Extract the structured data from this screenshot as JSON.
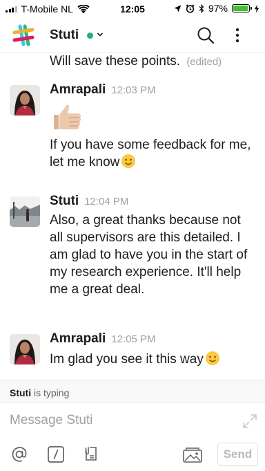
{
  "status_bar": {
    "carrier": "T-Mobile NL",
    "time": "12:05",
    "battery_percent": "97%",
    "battery_level": 0.97,
    "battery_color": "#3fc230"
  },
  "header": {
    "logo_icon": "slack-logo-icon",
    "channel_name": "Stuti",
    "presence_color": "#2bac76",
    "dropdown_icon": "chevron-down-icon",
    "search_icon": "search-icon",
    "more_icon": "more-vertical-icon"
  },
  "messages": {
    "previous": {
      "text": "Will save these points.",
      "edited_label": "(edited)"
    },
    "items": [
      {
        "author": "Amrapali",
        "time": "12:03 PM",
        "emoji": "thumbs-up-icon",
        "text": "If you have some feedback for me, let me know",
        "trailing_emoji": "slightly-smiling-face-icon"
      },
      {
        "author": "Stuti",
        "time": "12:04 PM",
        "text": "Also, a great thanks because not all supervisors are this detailed. I am glad to have you in the start of my research experience. It'll help me a great deal."
      },
      {
        "author": "Amrapali",
        "time": "12:05 PM",
        "text": "Im glad you see it this way",
        "trailing_emoji": "slightly-smiling-face-icon"
      }
    ]
  },
  "typing": {
    "user": "Stuti",
    "text": "is typing"
  },
  "composer": {
    "placeholder": "Message Stuti",
    "send_label": "Send",
    "tools": [
      "mention-icon",
      "slash-command-icon",
      "file-icon",
      "photo-icon"
    ],
    "expand_icon": "expand-icon"
  }
}
